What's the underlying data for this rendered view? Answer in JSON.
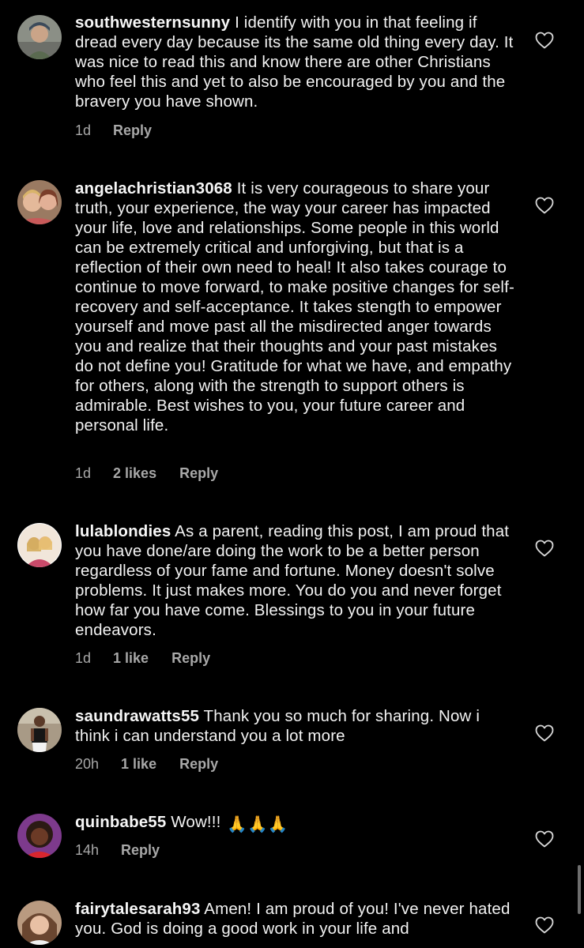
{
  "colors": {
    "background": "#000000",
    "text": "#f2f2f2",
    "meta": "#a8a8a8"
  },
  "comments": [
    {
      "username": "southwesternsunny",
      "text": "I identify with you in that feeling if dread every day because its the same old thing every day.  It was nice to read this and know there are other Christians who feel this and yet to also be encouraged by you and the bravery you have shown.",
      "time": "1d",
      "likes": "",
      "reply": "Reply",
      "avatar_icon": "profile-photo",
      "like_icon": "heart-outline-icon"
    },
    {
      "username": "angelachristian3068",
      "text": "It is very courageous to share your truth, your experience, the way your career has impacted your life, love and relationships. Some people in this world can be extremely critical and unforgiving, but that is a reflection of their own need to heal! It also takes courage to continue to move forward, to make positive changes for self-recovery and self-acceptance. It takes stength to empower yourself and move past all the misdirected anger towards you and realize that their thoughts and your past mistakes do not define you! Gratitude for what we have, and empathy for others, along with the strength to support others is admirable. Best wishes to you, your future career and personal life.",
      "time": "1d",
      "likes": "2 likes",
      "reply": "Reply",
      "avatar_icon": "profile-photo",
      "like_icon": "heart-outline-icon"
    },
    {
      "username": "lulablondies",
      "text": "As a parent, reading this post, I am proud that you have done/are doing the work to be a better person regardless of your fame and fortune. Money doesn't solve problems.  It just makes more. You do you and never forget  how far you have come. Blessings to you in your future endeavors.",
      "time": "1d",
      "likes": "1 like",
      "reply": "Reply",
      "avatar_icon": "profile-photo",
      "like_icon": "heart-outline-icon"
    },
    {
      "username": "saundrawatts55",
      "text": "Thank you so much for sharing. Now i think i can understand you a lot more",
      "time": "20h",
      "likes": "1 like",
      "reply": "Reply",
      "avatar_icon": "profile-photo",
      "like_icon": "heart-outline-icon"
    },
    {
      "username": "quinbabe55",
      "text": "Wow!!!",
      "emoji": "🙏🙏🙏",
      "time": "14h",
      "likes": "",
      "reply": "Reply",
      "avatar_icon": "profile-photo",
      "like_icon": "heart-outline-icon"
    },
    {
      "username": "fairytalesarah93",
      "text": "Amen! I am proud of you! I've never hated you. God is doing a good work in your life and",
      "time": "",
      "likes": "",
      "reply": "",
      "avatar_icon": "profile-photo",
      "like_icon": "heart-outline-icon"
    }
  ]
}
